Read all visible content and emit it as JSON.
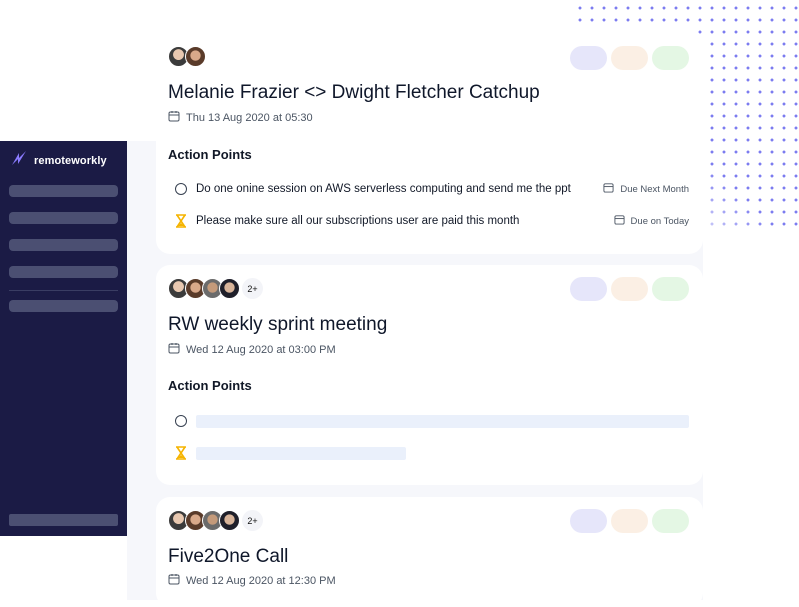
{
  "brand": {
    "name": "remoteworkly"
  },
  "colors": {
    "sidebar_bg": "#1b1b45",
    "accent": "#7c7cf0",
    "hourglass": "#f5b400",
    "pill_purple": "#e6e6fa",
    "pill_orange": "#fbefe4",
    "pill_green": "#e4f7e4"
  },
  "sidebar": {
    "items": [
      "",
      "",
      "",
      ""
    ],
    "footer_item": ""
  },
  "meetings": [
    {
      "title": "Melanie Frazier <> Dwight Fletcher Catchup",
      "datetime": "Thu 13 Aug 2020 at 05:30",
      "participants": [
        "avatar-1",
        "avatar-2"
      ],
      "section_label": "Action Points",
      "action_points": [
        {
          "status": "circle-icon",
          "text": "Do one onine session on AWS serverless computing and send me the ppt",
          "due": "Due Next Month"
        },
        {
          "status": "hourglass-icon",
          "text": "Please make sure all our subscriptions user are paid this month",
          "due": "Due on Today"
        }
      ]
    },
    {
      "title": "RW weekly sprint meeting",
      "datetime": "Wed 12 Aug 2020 at 03:00 PM",
      "participants": [
        "avatar-1",
        "avatar-2",
        "avatar-3",
        "avatar-4"
      ],
      "more_count": "2+",
      "section_label": "Action Points"
    },
    {
      "title": "Five2One Call",
      "datetime": "Wed 12 Aug 2020 at 12:30 PM",
      "participants": [
        "avatar-1",
        "avatar-2",
        "avatar-3",
        "avatar-4"
      ],
      "more_count": "2+"
    }
  ]
}
